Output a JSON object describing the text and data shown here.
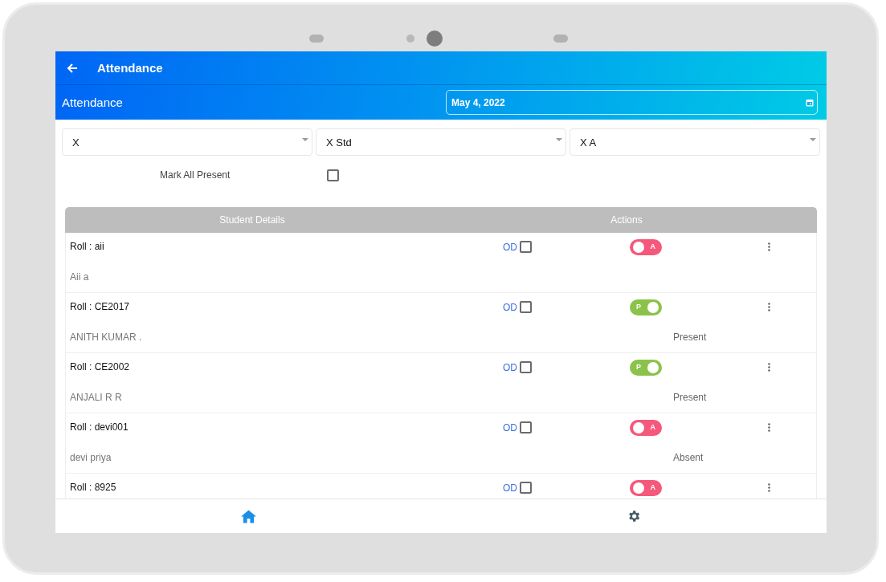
{
  "app_bar": {
    "title": "Attendance"
  },
  "subheader": {
    "title": "Attendance",
    "date": "May 4, 2022"
  },
  "filters": [
    {
      "value": "X"
    },
    {
      "value": "X Std"
    },
    {
      "value": "X A"
    }
  ],
  "mark_all": {
    "label": "Mark All Present",
    "checked": false
  },
  "table": {
    "columns": [
      "Student Details",
      "Actions"
    ],
    "rows": [
      {
        "roll": "Roll : aii",
        "name": "Aii a",
        "od_label": "OD",
        "od_checked": false,
        "present": false,
        "toggle_label": "A"
      },
      {
        "roll": "Roll : CE2017",
        "name": "ANITH KUMAR .",
        "od_label": "OD",
        "od_checked": false,
        "present": true,
        "toggle_label": "P",
        "status": "Present"
      },
      {
        "roll": "Roll : CE2002",
        "name": "ANJALI R R",
        "od_label": "OD",
        "od_checked": false,
        "present": true,
        "toggle_label": "P",
        "status": "Present"
      },
      {
        "roll": "Roll : devi001",
        "name": "devi priya",
        "od_label": "OD",
        "od_checked": false,
        "present": false,
        "toggle_label": "A",
        "status": "Absent"
      },
      {
        "roll": "Roll : 8925",
        "od_label": "OD",
        "od_checked": false,
        "present": false,
        "toggle_label": "A"
      }
    ]
  },
  "bottom_nav": [
    {
      "kind": "home",
      "selected": true
    },
    {
      "kind": "settings",
      "selected": false
    }
  ]
}
